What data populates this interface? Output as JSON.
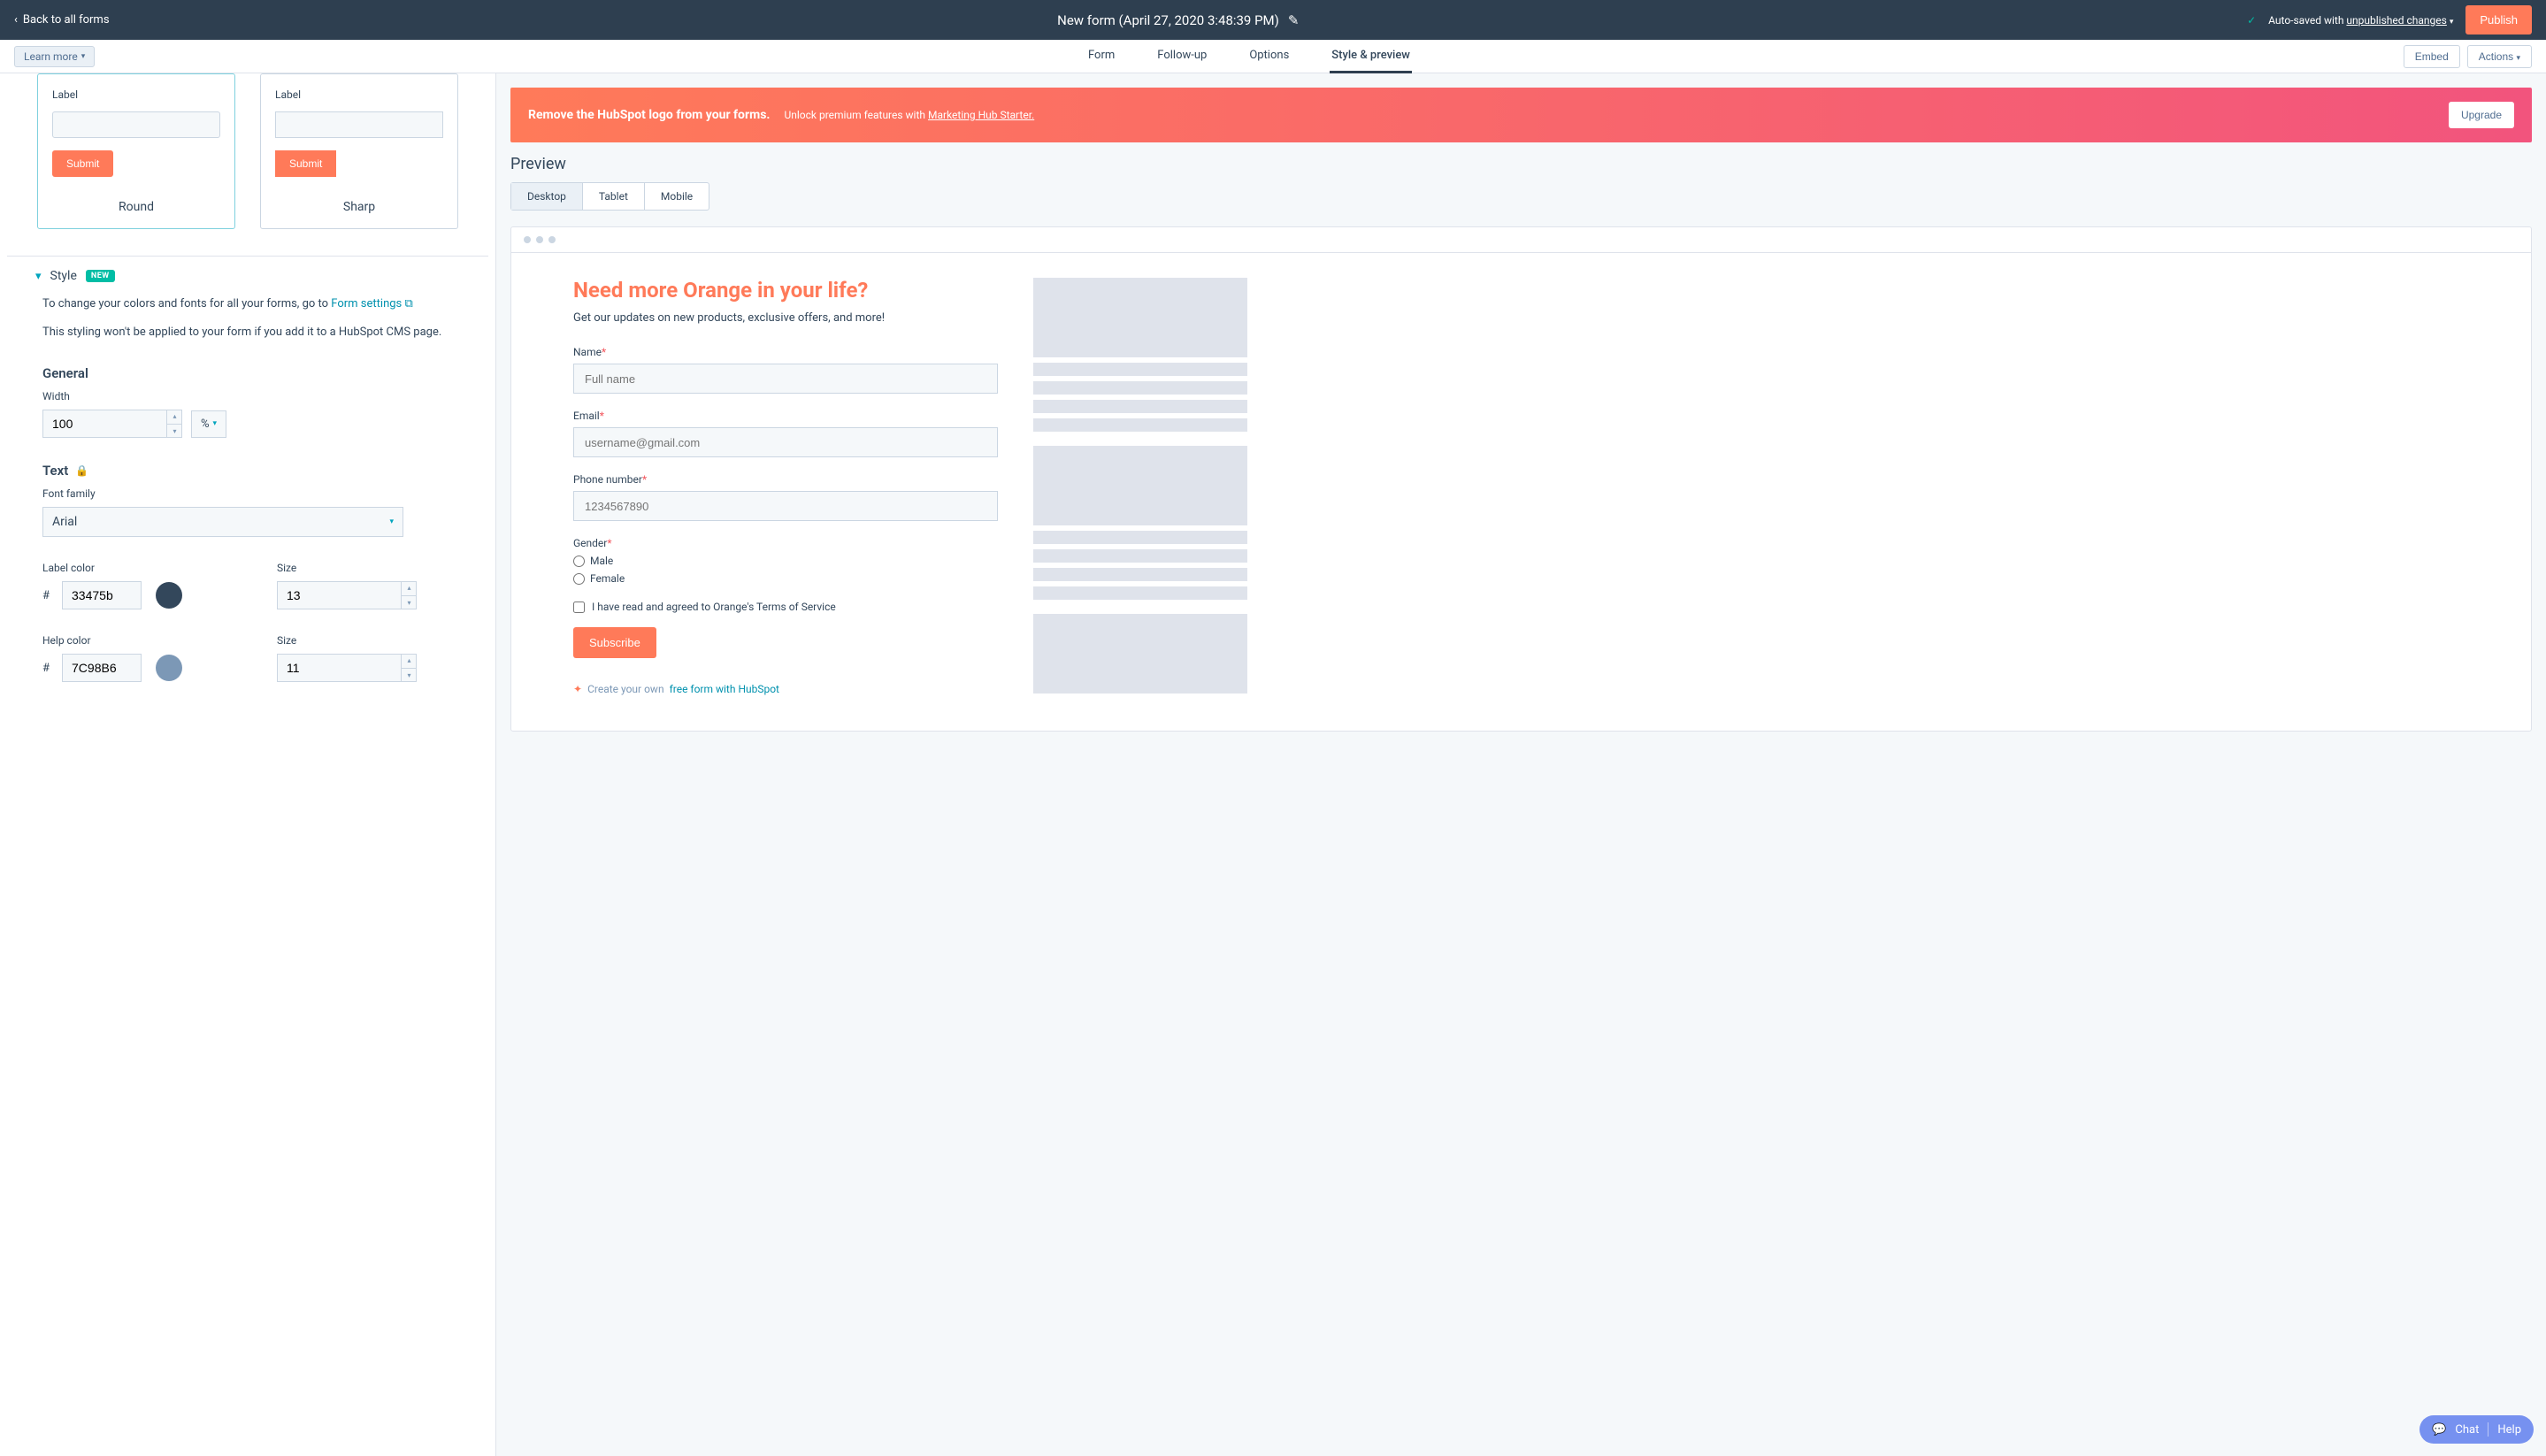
{
  "topbar": {
    "back": "Back to all forms",
    "title": "New form (April 27, 2020 3:48:39 PM)",
    "autosave_prefix": "Auto-saved with ",
    "autosave_link": "unpublished changes",
    "publish": "Publish"
  },
  "toolbar": {
    "learn_more": "Learn more",
    "tabs": [
      "Form",
      "Follow-up",
      "Options",
      "Style & preview"
    ],
    "embed": "Embed",
    "actions": "Actions"
  },
  "shapes": {
    "label": "Label",
    "submit": "Submit",
    "round": "Round",
    "sharp": "Sharp"
  },
  "style_section": {
    "title": "Style",
    "badge": "NEW",
    "help1_pre": "To change your colors and fonts for all your forms, go to ",
    "help1_link": "Form settings",
    "help2": "This styling won't be applied to your form if you add it to a HubSpot CMS page.",
    "general": "General",
    "width_label": "Width",
    "width_value": "100",
    "width_unit": "%",
    "text": "Text",
    "font_family_label": "Font family",
    "font_family_value": "Arial",
    "label_color": "Label color",
    "label_color_value": "33475b",
    "label_size_label": "Size",
    "label_size_value": "13",
    "help_color": "Help color",
    "help_color_value": "7C98B6",
    "help_size_label": "Size",
    "help_size_value": "11"
  },
  "banner": {
    "title": "Remove the HubSpot logo from your forms.",
    "sub_pre": "Unlock premium features with ",
    "sub_link": "Marketing Hub Starter.",
    "upgrade": "Upgrade"
  },
  "preview": {
    "heading": "Preview",
    "devices": [
      "Desktop",
      "Tablet",
      "Mobile"
    ],
    "form": {
      "title": "Need more Orange in your life?",
      "sub": "Get our updates on new products, exclusive offers, and more!",
      "name_label": "Name",
      "name_placeholder": "Full name",
      "email_label": "Email",
      "email_placeholder": "username@gmail.com",
      "phone_label": "Phone number",
      "phone_placeholder": "1234567890",
      "gender_label": "Gender",
      "gender_opt1": "Male",
      "gender_opt2": "Female",
      "terms": "I have read and agreed to Orange's Terms of Service",
      "subscribe": "Subscribe",
      "credit_pre": "Create your own ",
      "credit_link": "free form with HubSpot"
    }
  },
  "chat": {
    "chat": "Chat",
    "help": "Help"
  }
}
